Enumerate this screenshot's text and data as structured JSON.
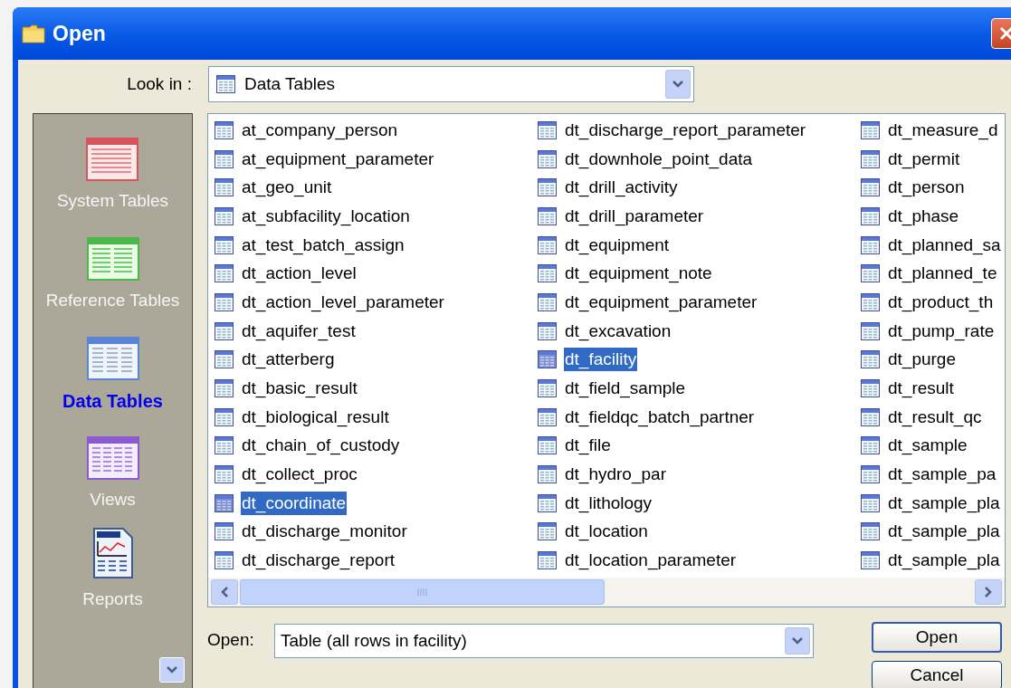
{
  "window": {
    "title": "Open"
  },
  "look_in": {
    "label": "Look in :",
    "value": "Data Tables"
  },
  "sidebar": {
    "items": [
      {
        "label": "System Tables",
        "kind": "system",
        "selected": false
      },
      {
        "label": "Reference Tables",
        "kind": "reference",
        "selected": false
      },
      {
        "label": "Data Tables",
        "kind": "data",
        "selected": true
      },
      {
        "label": "Views",
        "kind": "views",
        "selected": false
      },
      {
        "label": "Reports",
        "kind": "reports",
        "selected": false
      }
    ]
  },
  "list": {
    "columns": [
      [
        {
          "name": "at_company_person",
          "selected": false
        },
        {
          "name": "at_equipment_parameter",
          "selected": false
        },
        {
          "name": "at_geo_unit",
          "selected": false
        },
        {
          "name": "at_subfacility_location",
          "selected": false
        },
        {
          "name": "at_test_batch_assign",
          "selected": false
        },
        {
          "name": "dt_action_level",
          "selected": false
        },
        {
          "name": "dt_action_level_parameter",
          "selected": false
        },
        {
          "name": "dt_aquifer_test",
          "selected": false
        },
        {
          "name": "dt_atterberg",
          "selected": false
        },
        {
          "name": "dt_basic_result",
          "selected": false
        },
        {
          "name": "dt_biological_result",
          "selected": false
        },
        {
          "name": "dt_chain_of_custody",
          "selected": false
        },
        {
          "name": "dt_collect_proc",
          "selected": false
        },
        {
          "name": "dt_coordinate",
          "selected": true
        },
        {
          "name": "dt_discharge_monitor",
          "selected": false
        },
        {
          "name": "dt_discharge_report",
          "selected": false
        }
      ],
      [
        {
          "name": "dt_discharge_report_parameter",
          "selected": false
        },
        {
          "name": "dt_downhole_point_data",
          "selected": false
        },
        {
          "name": "dt_drill_activity",
          "selected": false
        },
        {
          "name": "dt_drill_parameter",
          "selected": false
        },
        {
          "name": "dt_equipment",
          "selected": false
        },
        {
          "name": "dt_equipment_note",
          "selected": false
        },
        {
          "name": "dt_equipment_parameter",
          "selected": false
        },
        {
          "name": "dt_excavation",
          "selected": false
        },
        {
          "name": "dt_facility",
          "selected": true
        },
        {
          "name": "dt_field_sample",
          "selected": false
        },
        {
          "name": "dt_fieldqc_batch_partner",
          "selected": false
        },
        {
          "name": "dt_file",
          "selected": false
        },
        {
          "name": "dt_hydro_par",
          "selected": false
        },
        {
          "name": "dt_lithology",
          "selected": false
        },
        {
          "name": "dt_location",
          "selected": false
        },
        {
          "name": "dt_location_parameter",
          "selected": false
        }
      ],
      [
        {
          "name": "dt_measure_d",
          "selected": false
        },
        {
          "name": "dt_permit",
          "selected": false
        },
        {
          "name": "dt_person",
          "selected": false
        },
        {
          "name": "dt_phase",
          "selected": false
        },
        {
          "name": "dt_planned_sa",
          "selected": false
        },
        {
          "name": "dt_planned_te",
          "selected": false
        },
        {
          "name": "dt_product_th",
          "selected": false
        },
        {
          "name": "dt_pump_rate",
          "selected": false
        },
        {
          "name": "dt_purge",
          "selected": false
        },
        {
          "name": "dt_result",
          "selected": false
        },
        {
          "name": "dt_result_qc",
          "selected": false
        },
        {
          "name": "dt_sample",
          "selected": false
        },
        {
          "name": "dt_sample_pa",
          "selected": false
        },
        {
          "name": "dt_sample_pla",
          "selected": false
        },
        {
          "name": "dt_sample_pla",
          "selected": false
        },
        {
          "name": "dt_sample_pla",
          "selected": false
        }
      ]
    ]
  },
  "open_as": {
    "label": "Open:",
    "value": "Table (all rows in facility)"
  },
  "buttons": [
    {
      "label": "Open",
      "default": true
    },
    {
      "label": "Cancel",
      "default": false
    }
  ]
}
